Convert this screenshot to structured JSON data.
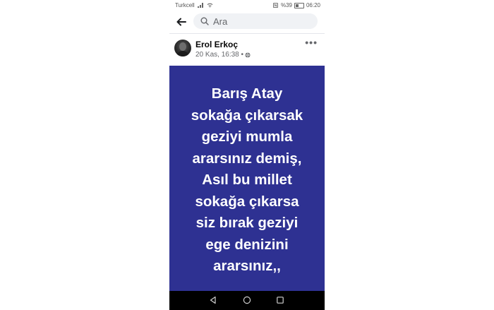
{
  "status_bar": {
    "carrier": "Turkcell",
    "battery": "%39",
    "time": "06:20"
  },
  "search": {
    "placeholder": "Ara"
  },
  "post": {
    "author": "Erol Erkoç",
    "timestamp": "20 Kas, 16:38 •",
    "image_text_lines": [
      "Barış Atay",
      "sokağa çıkarsak",
      "geziyi mumla",
      "ararsınız demiş,",
      "Asıl bu millet",
      "sokağa çıkarsa",
      "siz bırak geziyi",
      "ege denizini",
      "ararsınız,,"
    ],
    "image_bg": "#2e3192"
  },
  "icons": {
    "back": "arrow-left-icon",
    "search": "search-icon",
    "more": "more-options-icon",
    "privacy": "globe-icon",
    "nav_back": "triangle-back-icon",
    "nav_home": "circle-home-icon",
    "nav_recents": "square-recents-icon"
  }
}
